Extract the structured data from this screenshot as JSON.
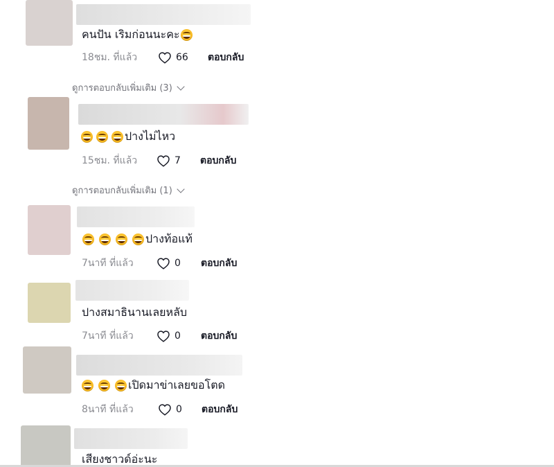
{
  "comments": [
    {
      "text": "คนปัน เริมก่อนนะคะ",
      "emoji_before": 0,
      "emoji_after": 1,
      "time": "18ชม. ที่แล้ว",
      "likes": "66",
      "reply": "ตอบกลับ",
      "avatar_color": "#d9d2d0",
      "more_replies": "ดูการตอบกลับเพิ่มเติม (3)"
    },
    {
      "text": "ปางไม่ไหว",
      "emoji_before": 3,
      "emoji_after": 0,
      "time": "15ชม. ที่แล้ว",
      "likes": "7",
      "reply": "ตอบกลับ",
      "avatar_color": "#c7b6ad",
      "more_replies": "ดูการตอบกลับเพิ่มเติม (1)"
    },
    {
      "text": "ปางท้อแท้",
      "emoji_before": 4,
      "emoji_after": 0,
      "time": "7นาที ที่แล้ว",
      "likes": "0",
      "reply": "ตอบกลับ",
      "avatar_color": "#e0cfcf"
    },
    {
      "text": "ปางสมาธินานเลยหลับ",
      "emoji_before": 0,
      "emoji_after": 0,
      "time": "7นาที ที่แล้ว",
      "likes": "0",
      "reply": "ตอบกลับ",
      "avatar_color": "#dcd6b0"
    },
    {
      "text": "เปิดมาข่าเลยขอโตด",
      "emoji_before": 3,
      "emoji_after": 0,
      "time": "8นาที ที่แล้ว",
      "likes": "0",
      "reply": "ตอบกลับ",
      "avatar_color": "#cfc9c2"
    },
    {
      "text": "เสียงชาวด์อ่ะนะ",
      "emoji_before": 0,
      "emoji_after": 0,
      "avatar_color": "#c8c8c2"
    }
  ],
  "icons": {
    "like": "heart-outline-icon",
    "expand": "chevron-down-icon",
    "emoji": "grinning-sweat-emoji-icon"
  },
  "colors": {
    "text": "#161823",
    "muted": "#8a8b91",
    "link": "#73747b"
  }
}
